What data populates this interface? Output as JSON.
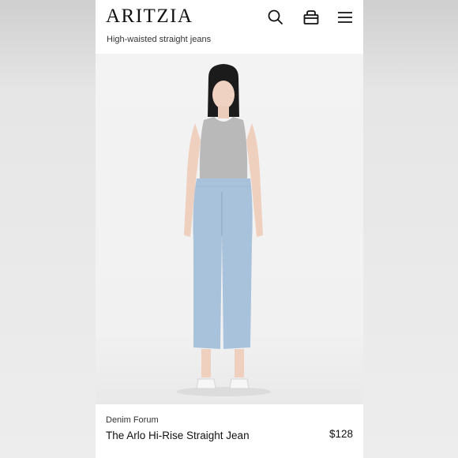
{
  "header": {
    "logo": "ARITZIA",
    "subtitle": "High-waisted straight jeans",
    "icons": [
      "search-icon",
      "bag-icon",
      "menu-icon"
    ]
  },
  "product": {
    "brand": "Denim Forum",
    "name": "The Arlo Hi-Rise Straight Jean",
    "price": "$128"
  },
  "colors": {
    "page_bg": "#ffffff",
    "text": "#111111",
    "denim": "#a9c2dc",
    "top": "#b8b8b8"
  }
}
